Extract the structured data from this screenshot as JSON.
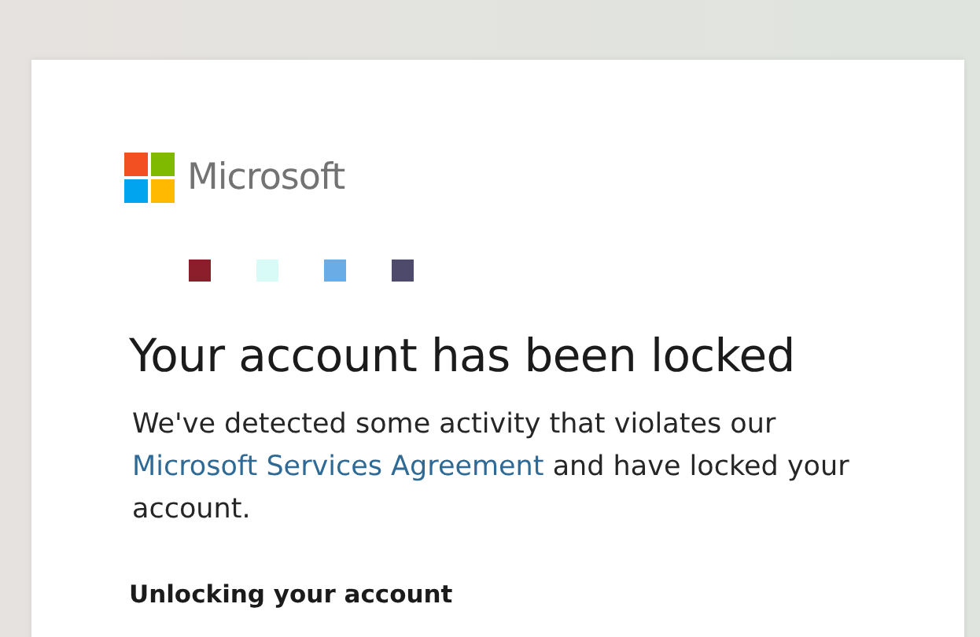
{
  "brand": {
    "name": "Microsoft"
  },
  "redacted_blocks": [
    {
      "color": "#8b1e2a"
    },
    {
      "color": "#d8fbf7"
    },
    {
      "color": "#6aace6"
    },
    {
      "color": "#4d4a6c"
    }
  ],
  "title": "Your account has been locked",
  "message": {
    "before": "We've detected some activity that violates our ",
    "link": "Microsoft Services Agreement",
    "after": " and have locked your account."
  },
  "section_heading": "Unlocking your account"
}
